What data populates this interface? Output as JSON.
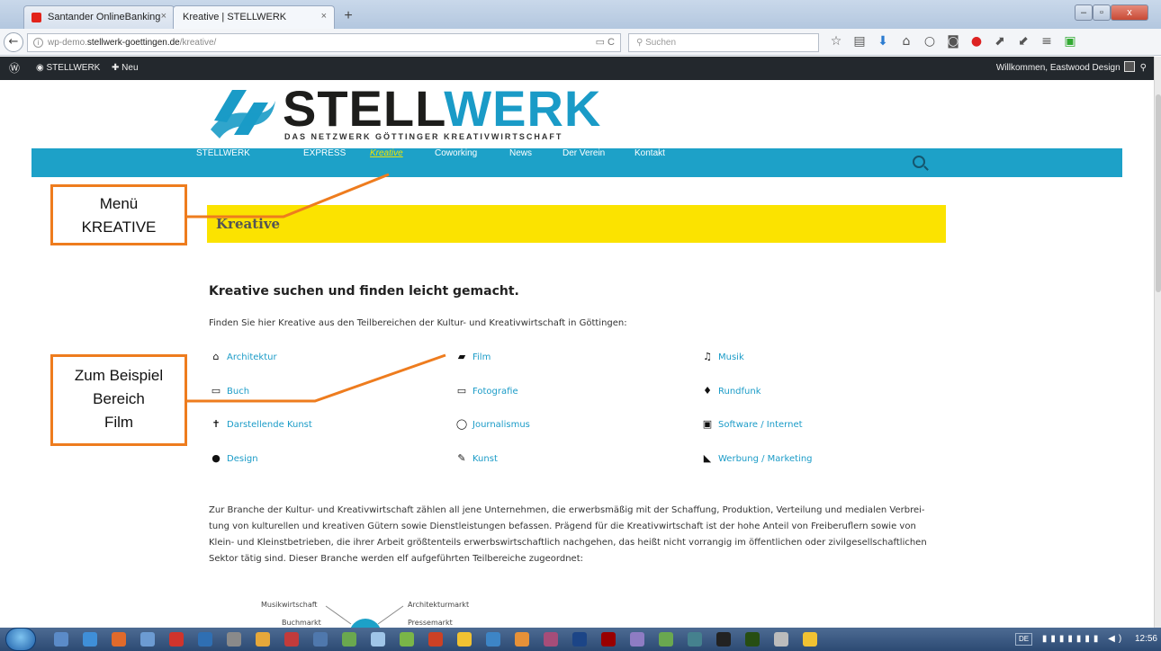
{
  "browser": {
    "tabs": [
      {
        "label": "Santander OnlineBanking",
        "close": "×"
      },
      {
        "label": "Kreative | STELLWERK",
        "close": "×"
      }
    ],
    "new_tab": "+",
    "window_buttons": {
      "minimize": "–",
      "maximize": "▫",
      "close": "x"
    },
    "back": "←",
    "url": {
      "prefix": "wp-demo.",
      "host": "stellwerk-goettingen.de",
      "path": "/kreative/"
    },
    "url_icons": "▭  C",
    "search_placeholder": "Suchen"
  },
  "adminbar": {
    "site": "STELLWERK",
    "new": "Neu",
    "greeting": "Willkommen, Eastwood Design"
  },
  "site": {
    "logo_a": "STELL",
    "logo_b": "WERK",
    "tagline": "DAS NETZWERK GÖTTINGER KREATIVWIRTSCHAFT",
    "nav": [
      "STELLWERK",
      "EXPRESS",
      "Kreative",
      "Coworking",
      "News",
      "Der Verein",
      "Kontakt"
    ],
    "banner": "Kreative",
    "section_title": "Kreative suchen und finden leicht gemacht.",
    "intro": "Finden Sie hier Kreative aus den Teilbereichen der Kultur- und Kreativwirtschaft in Göttingen:",
    "categories": [
      {
        "label": "Architektur",
        "icon": "home-icon"
      },
      {
        "label": "Film",
        "icon": "film-icon"
      },
      {
        "label": "Musik",
        "icon": "music-icon"
      },
      {
        "label": "Buch",
        "icon": "book-icon"
      },
      {
        "label": "Fotografie",
        "icon": "camera-icon"
      },
      {
        "label": "Rundfunk",
        "icon": "microphone-icon"
      },
      {
        "label": "Darstellende Kunst",
        "icon": "performer-icon"
      },
      {
        "label": "Journalismus",
        "icon": "speech-bubble-icon"
      },
      {
        "label": "Software / Internet",
        "icon": "computer-icon"
      },
      {
        "label": "Design",
        "icon": "user-icon"
      },
      {
        "label": "Kunst",
        "icon": "brush-icon"
      },
      {
        "label": "Werbung / Marketing",
        "icon": "megaphone-icon"
      }
    ],
    "body": [
      "Zur Branche der Kultur- und Kreativwirtschaft zählen all jene Unternehmen, die erwerbsmäßig mit der Schaffung, Produktion, Verteilung und medialen Verbrei-",
      "tung von kulturellen und kreativen Gütern sowie Dienstleistungen befassen. Prägend für die Kreativwirtschaft ist der hohe Anteil von Freiberuflern sowie von",
      "Klein- und Kleinstbetrieben, die ihrer Arbeit größtenteils erwerbswirtschaftlich nachgehen, das heißt nicht vorrangig im öffentlichen oder zivilgesellschaftlichen",
      "Sektor tätig sind. Dieser Branche werden elf aufgeführten Teilbereiche zugeordnet:"
    ],
    "diagram": [
      "Musikwirtschaft",
      "Architekturmarkt",
      "Buchmarkt",
      "Pressemarkt"
    ]
  },
  "annotations": [
    {
      "lines": [
        "Menü",
        "KREATIVE"
      ]
    },
    {
      "lines": [
        "Zum Beispiel",
        "Bereich",
        "Film"
      ]
    }
  ],
  "taskbar": {
    "lang": "DE",
    "time": "12:56"
  },
  "colors": {
    "brand_blue": "#1da1c8",
    "banner_yellow": "#fbe300",
    "annotation_orange": "#ee7c1e",
    "admin_dark": "#23282d"
  }
}
